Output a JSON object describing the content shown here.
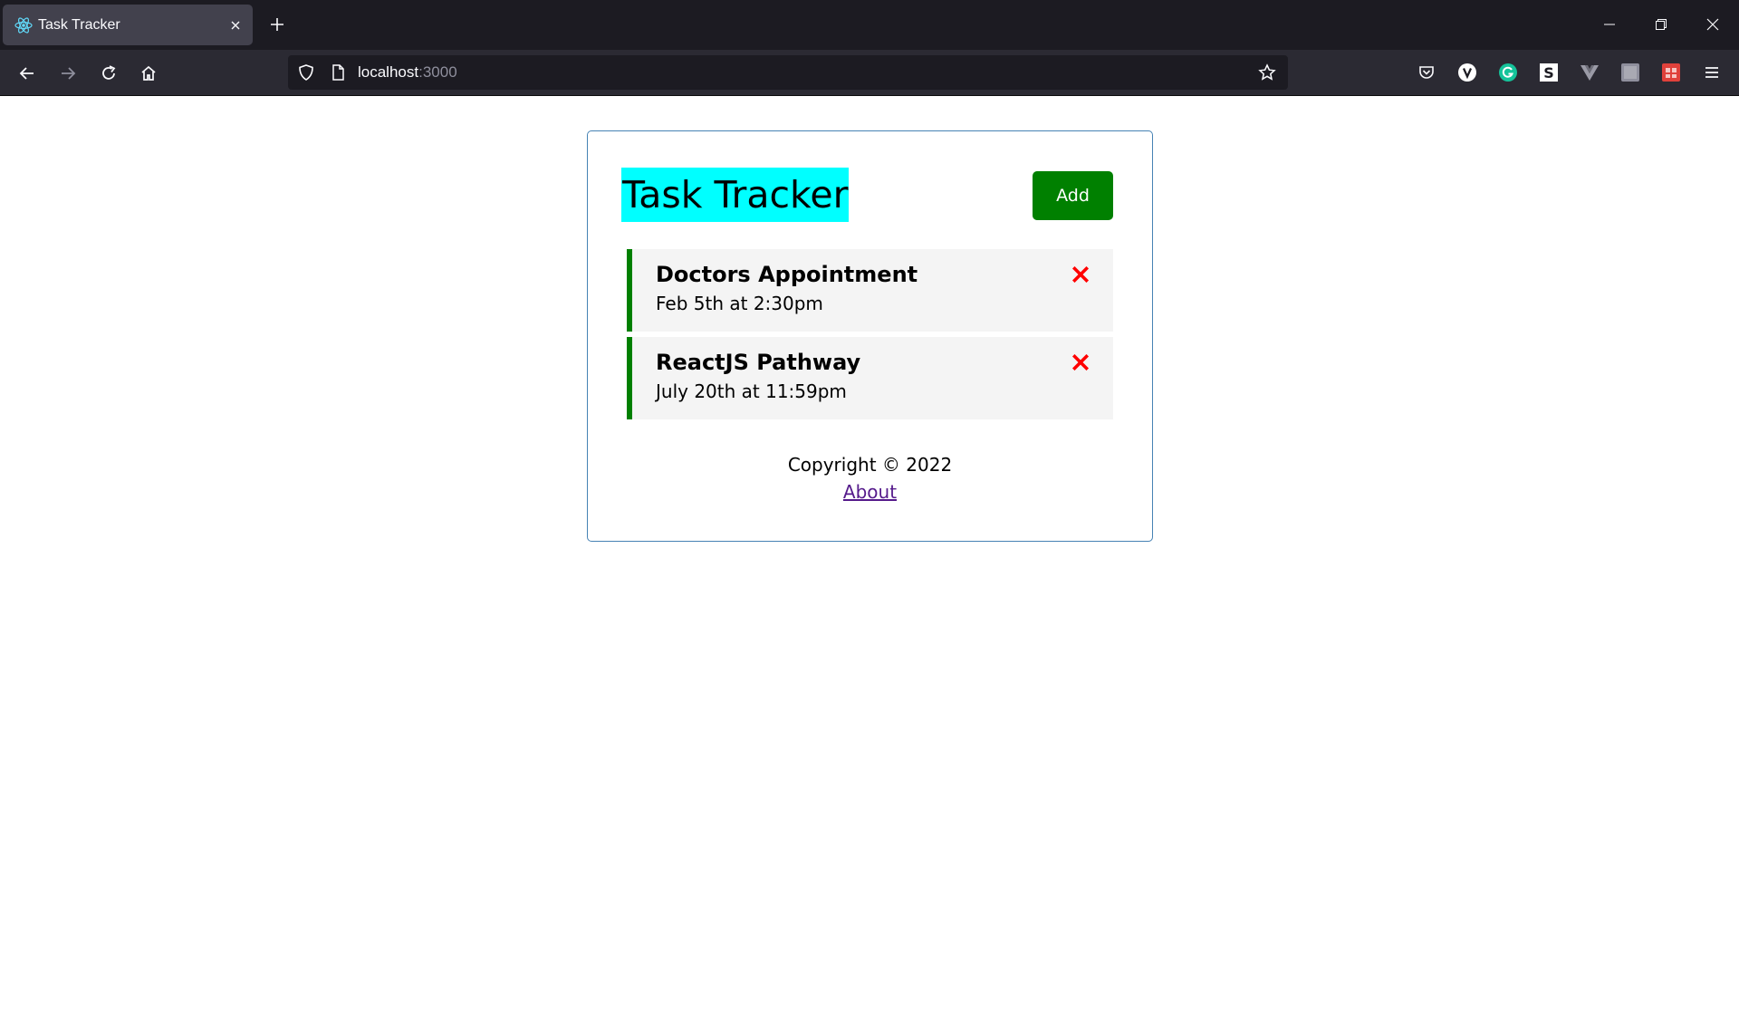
{
  "browser": {
    "tab": {
      "title": "Task Tracker",
      "favicon": "react-icon"
    },
    "url": {
      "host": "localhost",
      "port": ":3000"
    },
    "extensions": [
      "pocket-icon",
      "v-icon",
      "grammarly-icon",
      "s-icon",
      "vue-devtools-icon",
      "gray-square-icon",
      "red-extension-icon"
    ]
  },
  "app": {
    "title": "Task Tracker",
    "add_button": "Add",
    "tasks": [
      {
        "name": "Doctors Appointment",
        "day": "Feb 5th at 2:30pm",
        "reminder": true
      },
      {
        "name": "ReactJS Pathway",
        "day": "July 20th at 11:59pm",
        "reminder": true
      }
    ],
    "footer": {
      "copyright": "Copyright © 2022",
      "about_link": "About"
    }
  },
  "colors": {
    "title_highlight": "#00ffff",
    "add_button": "#008000",
    "reminder_border": "#008000",
    "delete_icon": "#ff0000",
    "container_border": "#4682b4",
    "link": "#551a8b"
  }
}
